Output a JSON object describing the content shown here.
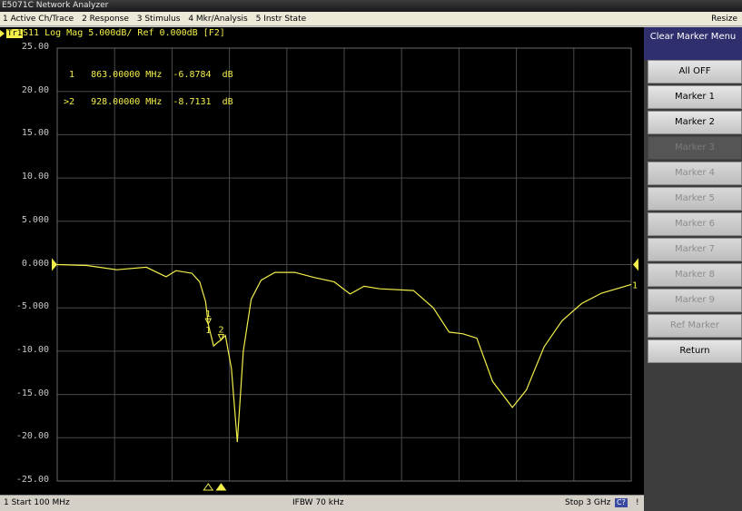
{
  "window": {
    "title": "E5071C Network Analyzer"
  },
  "menu": {
    "items": [
      "1 Active Ch/Trace",
      "2 Response",
      "3 Stimulus",
      "4 Mkr/Analysis",
      "5 Instr State"
    ],
    "resize": "Resize"
  },
  "trace_header": {
    "trace_tag": "Tr1",
    "text": "S11 Log Mag 5.000dB/ Ref 0.000dB [F2]"
  },
  "marker_readout": [
    " 1   863.00000 MHz  -6.8784  dB",
    ">2   928.00000 MHz  -8.7131  dB"
  ],
  "plot_labels": {
    "m1": "1",
    "m2": "2",
    "m1_low": "1",
    "trace_end": "1"
  },
  "trace_color": "#f2ef4a",
  "chart_data": {
    "type": "line",
    "x_start_mhz": 100,
    "x_stop_mhz": 3000,
    "ylim": [
      -25,
      25
    ],
    "y_ticks": [
      "25.00",
      "20.00",
      "15.00",
      "10.00",
      "5.000",
      "0.000",
      "-5.000",
      "-10.00",
      "-15.00",
      "-20.00",
      "-25.00"
    ],
    "grid": true,
    "series": [
      {
        "points": [
          [
            100,
            0.0
          ],
          [
            250,
            -0.1
          ],
          [
            400,
            -0.6
          ],
          [
            550,
            -0.3
          ],
          [
            650,
            -1.4
          ],
          [
            700,
            -0.7
          ],
          [
            780,
            -1.0
          ],
          [
            820,
            -2.0
          ],
          [
            850,
            -4.3
          ],
          [
            863,
            -6.9
          ],
          [
            890,
            -9.4
          ],
          [
            910,
            -9.0
          ],
          [
            928,
            -8.7
          ],
          [
            950,
            -8.2
          ],
          [
            980,
            -12.0
          ],
          [
            1010,
            -20.5
          ],
          [
            1040,
            -10.0
          ],
          [
            1080,
            -4.0
          ],
          [
            1130,
            -1.8
          ],
          [
            1200,
            -0.9
          ],
          [
            1300,
            -0.9
          ],
          [
            1400,
            -1.5
          ],
          [
            1500,
            -2.0
          ],
          [
            1580,
            -3.4
          ],
          [
            1650,
            -2.5
          ],
          [
            1730,
            -2.8
          ],
          [
            1900,
            -3.0
          ],
          [
            2000,
            -5.0
          ],
          [
            2080,
            -7.8
          ],
          [
            2150,
            -8.0
          ],
          [
            2220,
            -8.5
          ],
          [
            2300,
            -13.5
          ],
          [
            2400,
            -16.5
          ],
          [
            2470,
            -14.5
          ],
          [
            2560,
            -9.5
          ],
          [
            2650,
            -6.5
          ],
          [
            2750,
            -4.5
          ],
          [
            2850,
            -3.3
          ],
          [
            3000,
            -2.3
          ]
        ]
      }
    ],
    "markers": [
      {
        "id": 1,
        "freq_mhz": 863,
        "value_db": -6.8784
      },
      {
        "id": 2,
        "freq_mhz": 928,
        "value_db": -8.7131
      }
    ],
    "ref_level_db": 0
  },
  "status": {
    "start": "1  Start 100 MHz",
    "ifbw": "IFBW 70 kHz",
    "stop": "Stop 3 GHz",
    "c7": "C?",
    "excl": "!"
  },
  "softkeys": {
    "header": "Clear Marker Menu",
    "items": [
      {
        "label": "All OFF",
        "state": "enabled"
      },
      {
        "label": "Marker 1",
        "state": "enabled"
      },
      {
        "label": "Marker 2",
        "state": "enabled"
      },
      {
        "label": "Marker 3",
        "state": "selected"
      },
      {
        "label": "Marker 4",
        "state": "disabled"
      },
      {
        "label": "Marker 5",
        "state": "disabled"
      },
      {
        "label": "Marker 6",
        "state": "disabled"
      },
      {
        "label": "Marker 7",
        "state": "disabled"
      },
      {
        "label": "Marker 8",
        "state": "disabled"
      },
      {
        "label": "Marker 9",
        "state": "disabled"
      },
      {
        "label": "Ref Marker",
        "state": "disabled"
      }
    ],
    "return": "Return"
  }
}
